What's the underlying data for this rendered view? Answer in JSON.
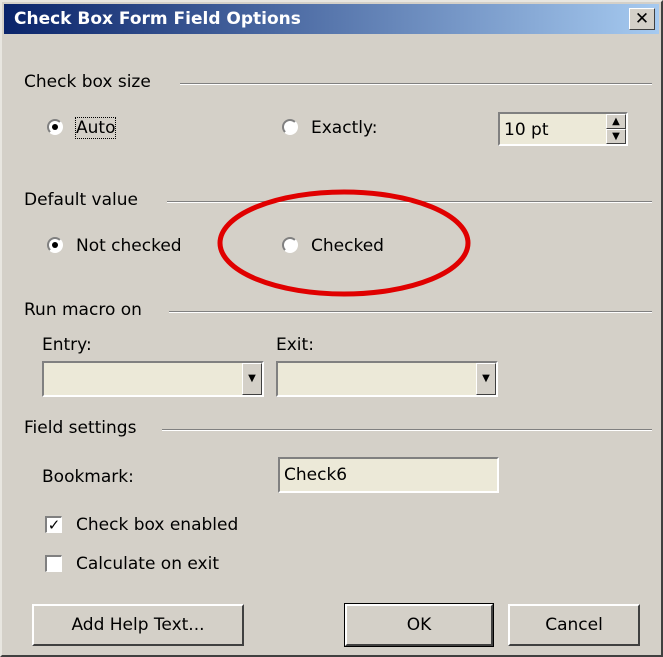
{
  "title": "Check Box Form Field Options",
  "close_glyph": "✕",
  "size_group": {
    "label": "Check box size",
    "auto_label": "Auto",
    "exactly_label": "Exactly:",
    "selected": "auto",
    "size_value": "10 pt"
  },
  "default_group": {
    "label": "Default value",
    "not_checked_label": "Not checked",
    "checked_label": "Checked",
    "selected": "not_checked",
    "highlight_color": "#e00000"
  },
  "macro_group": {
    "label": "Run macro on",
    "entry_label": "Entry:",
    "exit_label": "Exit:",
    "entry_value": "",
    "exit_value": ""
  },
  "field_group": {
    "label": "Field settings",
    "bookmark_label": "Bookmark:",
    "bookmark_value": "Check6",
    "enabled_label": "Check box enabled",
    "enabled": true,
    "calc_label": "Calculate on exit",
    "calc": false
  },
  "buttons": {
    "help": "Add Help Text...",
    "ok": "OK",
    "cancel": "Cancel"
  }
}
